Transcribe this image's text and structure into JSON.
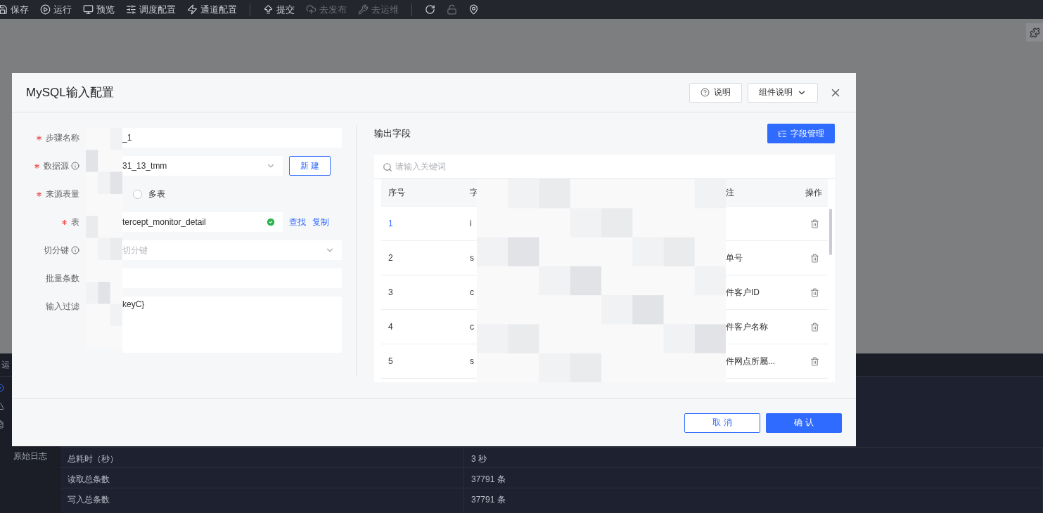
{
  "toolbar": [
    {
      "kind": "save",
      "label": "保存",
      "disabled": false
    },
    {
      "kind": "run",
      "label": "运行",
      "disabled": false
    },
    {
      "kind": "preview",
      "label": "预览",
      "disabled": false
    },
    {
      "kind": "schedule",
      "label": "调度配置",
      "disabled": false
    },
    {
      "kind": "channel",
      "label": "通道配置",
      "disabled": false
    },
    {
      "kind": "divider"
    },
    {
      "kind": "submit",
      "label": "提交",
      "disabled": false
    },
    {
      "kind": "publish",
      "label": "去发布",
      "disabled": true
    },
    {
      "kind": "ops",
      "label": "去运维",
      "disabled": true
    },
    {
      "kind": "divider"
    },
    {
      "kind": "refresh",
      "disabled": false
    },
    {
      "kind": "lock",
      "disabled": true
    },
    {
      "kind": "location",
      "disabled": false
    }
  ],
  "bottom_panel": {
    "tab_label": "运",
    "side_label": "原始日志",
    "rows": [
      {
        "name": "总耗时（秒）",
        "value": "3 秒"
      },
      {
        "name": "读取总条数",
        "value": "37791 条"
      },
      {
        "name": "写入总条数",
        "value": "37791 条"
      }
    ]
  },
  "dialog": {
    "title": "MySQL输入配置",
    "help_button": "说明",
    "component_button": "组件说明",
    "form": [
      {
        "kind": "input",
        "label": "步骤名称",
        "required": true,
        "info": false,
        "value": "_1"
      },
      {
        "kind": "select",
        "label": "数据源",
        "required": true,
        "info": true,
        "value": "31_13_tmm",
        "action": "新 建"
      },
      {
        "kind": "radio",
        "label": "来源表量",
        "required": true,
        "info": false,
        "options": [
          {
            "label": "多表",
            "selected": false
          }
        ]
      },
      {
        "kind": "table",
        "label": "表",
        "required": true,
        "info": false,
        "value": "tercept_monitor_detail",
        "valid": true,
        "links": [
          "查找",
          "复制"
        ]
      },
      {
        "kind": "select",
        "label": "切分键",
        "required": false,
        "info": true,
        "placeholder": "切分键"
      },
      {
        "kind": "input",
        "label": "批量条数",
        "required": false,
        "info": false
      },
      {
        "kind": "textarea",
        "label": "输入过滤",
        "required": false,
        "info": false,
        "value": "keyC}"
      }
    ],
    "output": {
      "title": "输出字段",
      "manage_button": "字段管理",
      "search_placeholder": "请输入关键词",
      "columns": [
        "序号",
        "字",
        "注",
        "操作"
      ],
      "rows": [
        {
          "index": "1",
          "field": "i"
        },
        {
          "index": "2",
          "field": "s",
          "remark": "单号"
        },
        {
          "index": "3",
          "field": "c",
          "remark": "件客户ID"
        },
        {
          "index": "4",
          "field": "c",
          "remark": "件客户名称"
        },
        {
          "index": "5",
          "field": "s",
          "remark": "件网点所屬..."
        }
      ]
    },
    "cancel": "取 消",
    "confirm": "确 认"
  }
}
